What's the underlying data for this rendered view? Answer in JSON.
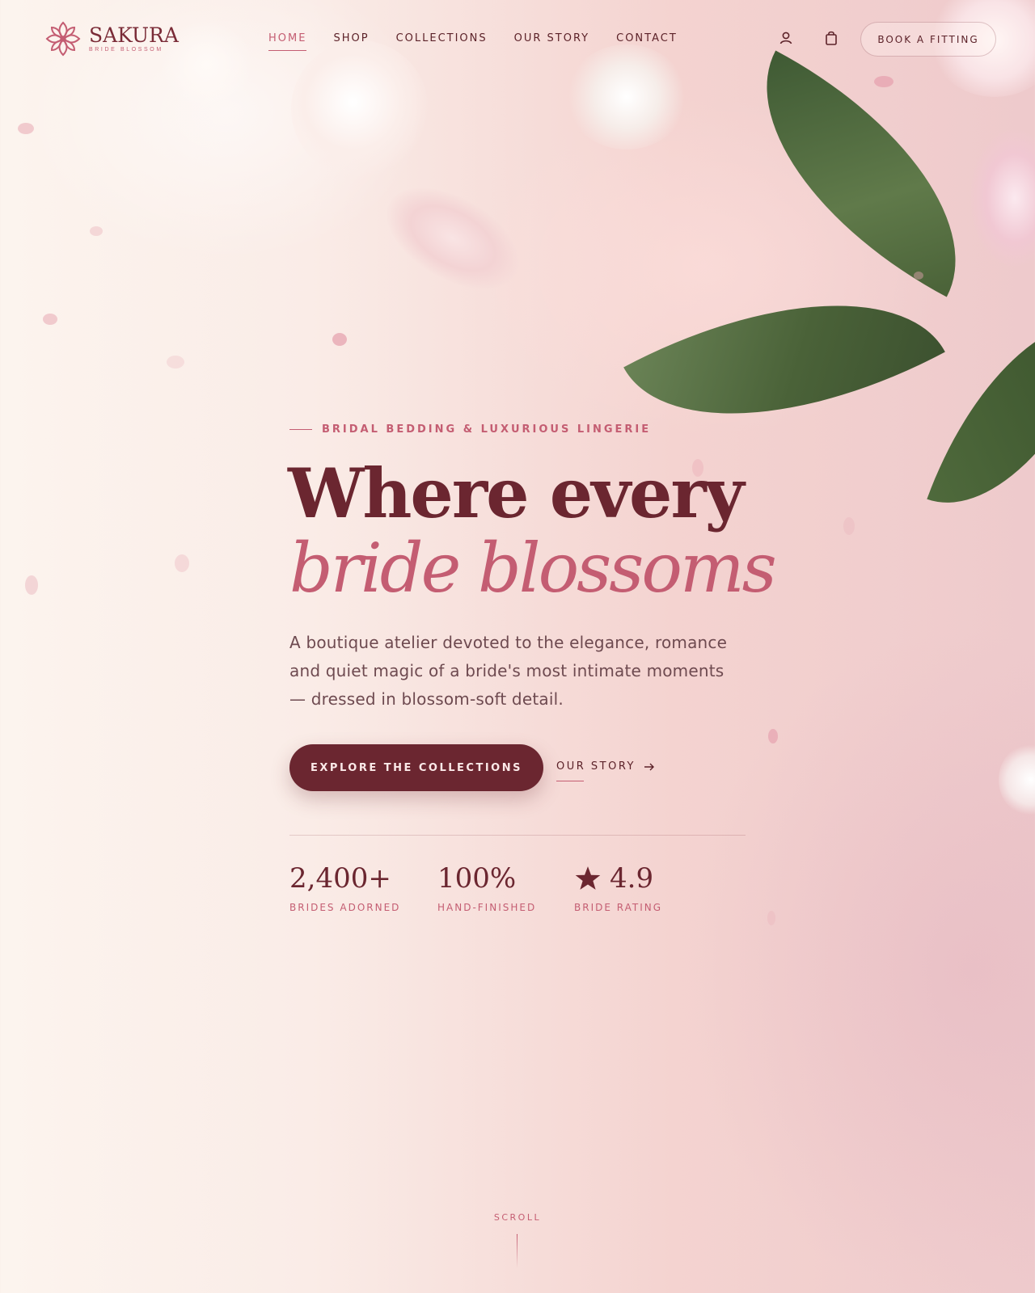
{
  "brand": {
    "name": "SAKURA",
    "tagline": "BRIDE BLOSSOM",
    "accent": "#c45d72",
    "primary": "#6b2630"
  },
  "nav": {
    "items": [
      {
        "label": "HOME",
        "active": true
      },
      {
        "label": "SHOP",
        "active": false
      },
      {
        "label": "COLLECTIONS",
        "active": false
      },
      {
        "label": "OUR STORY",
        "active": false
      },
      {
        "label": "CONTACT",
        "active": false
      }
    ],
    "icons": [
      "user-icon",
      "shopping-bag-icon"
    ],
    "cta_label": "BOOK A FITTING"
  },
  "hero": {
    "eyebrow": "BRIDAL BEDDING & LUXURIOUS LINGERIE",
    "title_line1": "Where every",
    "title_line2": "bride blossoms",
    "lede": "A boutique atelier devoted to the elegance, romance and quiet magic of a bride's most intimate moments — dressed in blossom-soft detail.",
    "primary_cta": "EXPLORE THE COLLECTIONS",
    "secondary_cta": "OUR STORY",
    "secondary_cta_icon": "arrow-right-icon"
  },
  "stats": [
    {
      "value": "2,400+",
      "label": "BRIDES ADORNED"
    },
    {
      "value": "100%",
      "label": "HAND-FINISHED"
    },
    {
      "value": "4.9",
      "label": "BRIDE RATING",
      "icon": "star-icon"
    }
  ],
  "scroll": {
    "label": "SCROLL"
  }
}
